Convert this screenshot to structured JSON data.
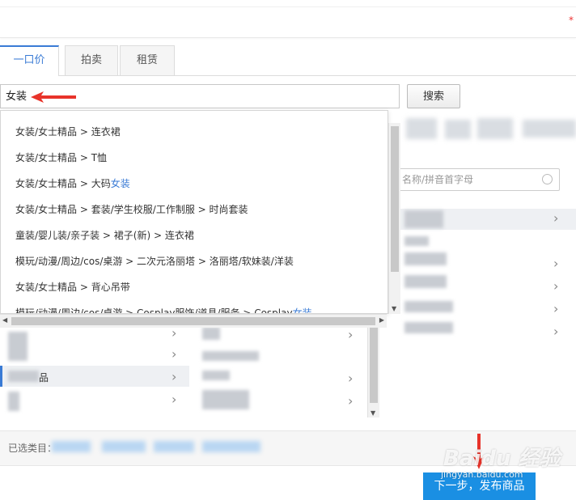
{
  "top_mark": "*",
  "tabs": [
    {
      "label": "一口价",
      "active": true
    },
    {
      "label": "拍卖",
      "active": false
    },
    {
      "label": "租赁",
      "active": false
    }
  ],
  "search": {
    "value": "女装",
    "button_label": "搜索"
  },
  "suggestions": [
    {
      "text": "女装/女士精品 > 连衣裙",
      "highlight": ""
    },
    {
      "text": "女装/女士精品 > T恤",
      "highlight": ""
    },
    {
      "text": "女装/女士精品 > 大码",
      "highlight": "女装"
    },
    {
      "text": "女装/女士精品 > 套装/学生校服/工作制服 > 时尚套装",
      "highlight": ""
    },
    {
      "text": "童装/婴儿装/亲子装 > 裙子(新) > 连衣裙",
      "highlight": ""
    },
    {
      "text": "模玩/动漫/周边/cos/桌游 > 二次元洛丽塔 > 洛丽塔/软妹装/洋装",
      "highlight": ""
    },
    {
      "text": "女装/女士精品 > 背心吊带",
      "highlight": ""
    },
    {
      "text": "模玩/动漫/周边/cos/桌游 > Cosplay服饰/道具/服务 > Cosplay",
      "highlight": "女装"
    }
  ],
  "category_search_placeholder": "名称/拼音首字母",
  "left_column_partial_label": "品",
  "selected_label": "已选类目：",
  "next_button_label": "下一步，发布商品",
  "watermark": {
    "text": "Baidu 经验",
    "url": "jingyan.baidu.com"
  },
  "colors": {
    "accent": "#3a7bd5",
    "button": "#1a8fe3",
    "annotation_arrow": "#e8332a"
  },
  "icons": {
    "arrow": "red-arrow-annotation",
    "search": "search-icon",
    "chevron": "chevron-right-icon"
  }
}
